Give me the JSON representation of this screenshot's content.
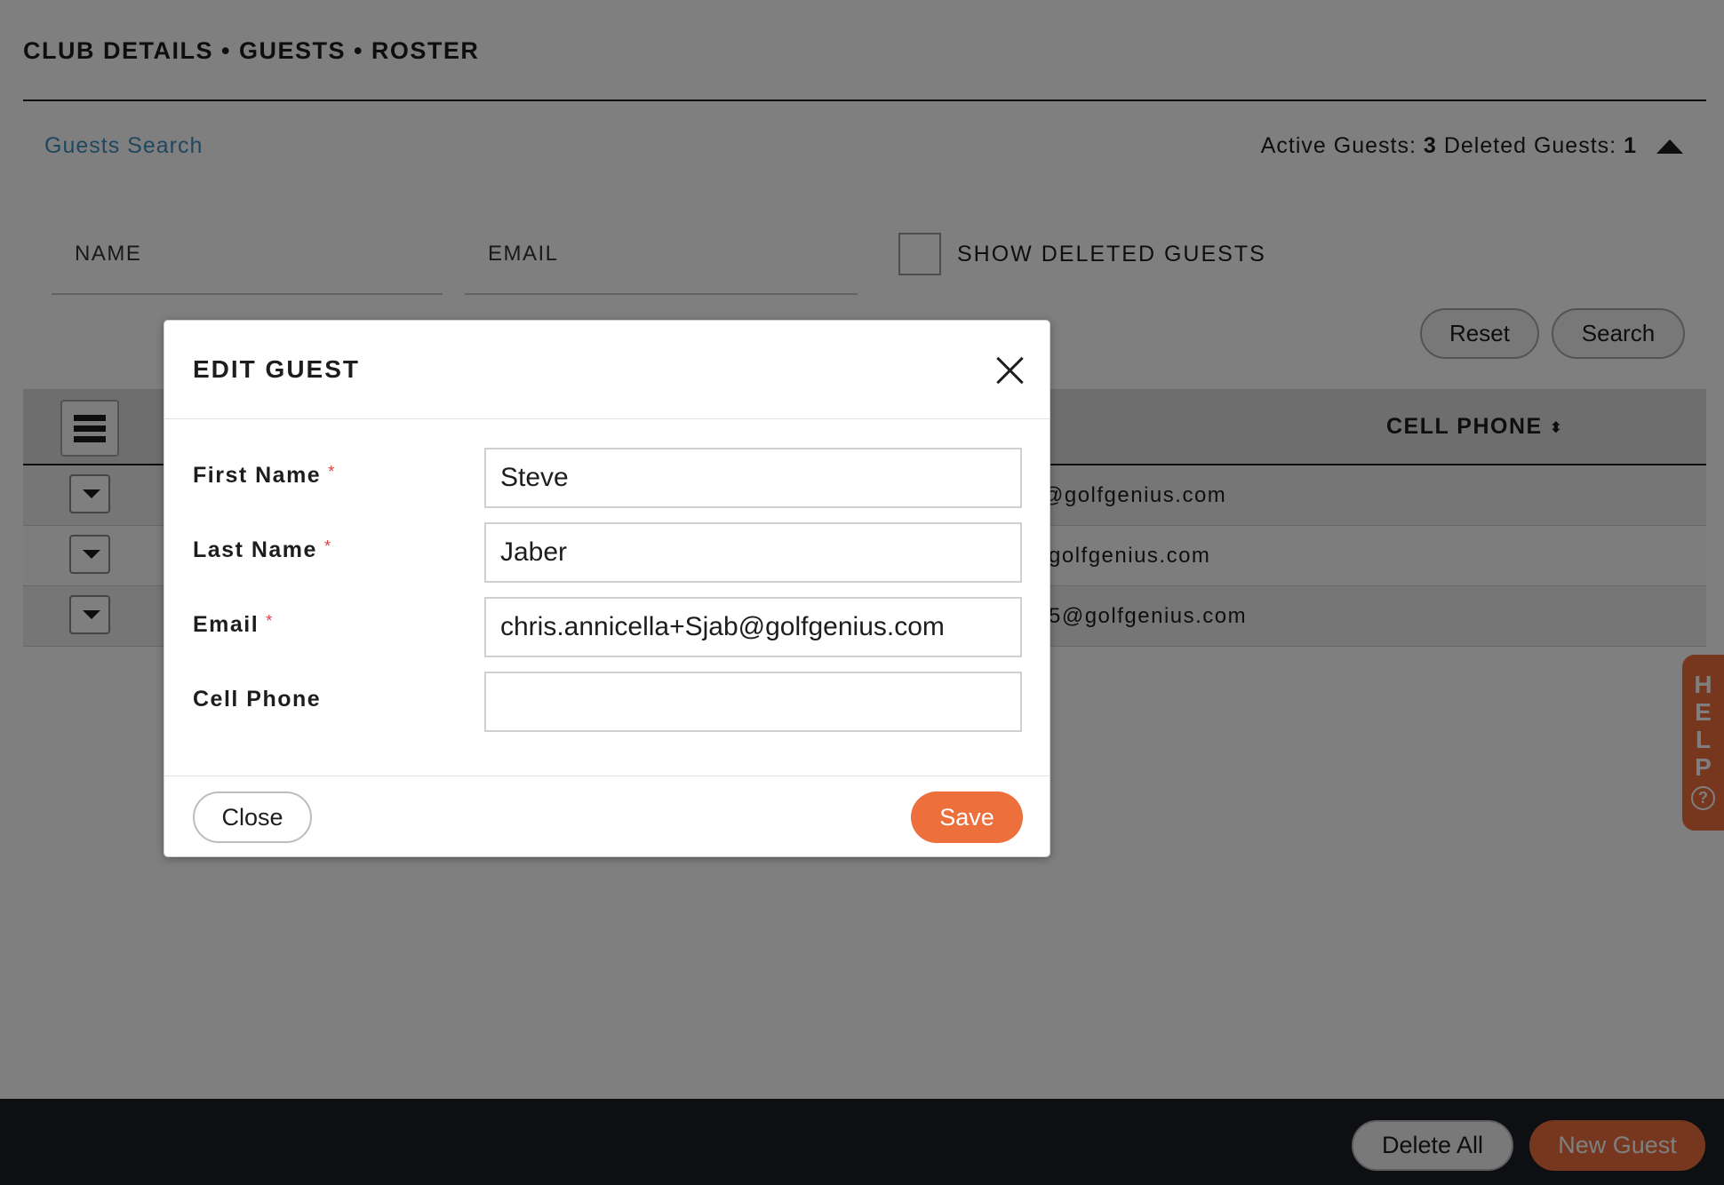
{
  "header": {
    "breadcrumb": "CLUB DETAILS • GUESTS • ROSTER"
  },
  "search": {
    "title": "Guests Search",
    "name_placeholder": "NAME",
    "email_placeholder": "EMAIL",
    "show_deleted_label": "SHOW DELETED GUESTS",
    "show_deleted_checked": false,
    "reset_label": "Reset",
    "search_label": "Search"
  },
  "counts": {
    "active_label": "Active Guests:",
    "active_value": "3",
    "deleted_label": "Deleted Guests:",
    "deleted_value": "1"
  },
  "table": {
    "cell_phone_header": "CELL PHONE",
    "rows": [
      {
        "email_visible": "@golfgenius.com"
      },
      {
        "email_visible": "golfgenius.com"
      },
      {
        "email_visible": "5@golfgenius.com"
      }
    ]
  },
  "help": {
    "letters": [
      "H",
      "E",
      "L",
      "P"
    ],
    "question": "?"
  },
  "footer": {
    "delete_all_label": "Delete All",
    "new_guest_label": "New Guest"
  },
  "modal": {
    "title": "EDIT GUEST",
    "fields": {
      "first_name_label": "First Name",
      "first_name_value": "Steve",
      "last_name_label": "Last Name",
      "last_name_value": "Jaber",
      "email_label": "Email",
      "email_value": "chris.annicella+Sjab@golfgenius.com",
      "cell_phone_label": "Cell Phone",
      "cell_phone_value": ""
    },
    "required_mark": "*",
    "close_label": "Close",
    "save_label": "Save"
  },
  "colors": {
    "accent": "#ec6f3c",
    "link": "#3e8fc0",
    "required": "#e23c3c",
    "footer_bg": "#1d1f27"
  }
}
